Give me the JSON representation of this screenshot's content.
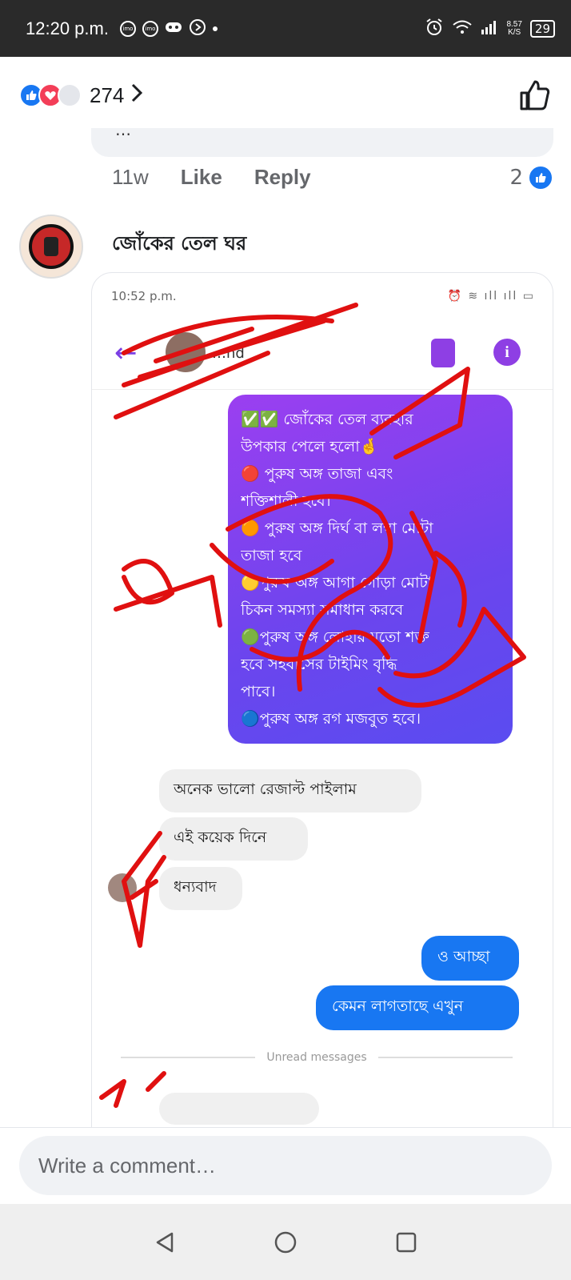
{
  "status_bar": {
    "time": "12:20 p.m.",
    "net_speed_value": "8.57",
    "net_speed_unit": "K/S",
    "battery": "29",
    "icons": [
      "imo-icon",
      "imo-icon",
      "game-icon",
      "play-icon",
      "alarm-icon",
      "wifi-icon",
      "signal-icon"
    ]
  },
  "reactions": {
    "count": "274",
    "types": [
      "like",
      "love"
    ]
  },
  "prev_comment": {
    "partial_text": "…",
    "time": "11w",
    "like_label": "Like",
    "reply_label": "Reply",
    "reaction_count": "2"
  },
  "comment": {
    "author": "জোঁকের তেল ঘর",
    "screenshot": {
      "time": "10:52 p.m.",
      "contact_name": "…nd",
      "purple_message": [
        "✅✅ জোঁকের তেল ব্যবহার",
        "উপকার পেলে হলো🤞",
        "🔴 পুরুষ অঙ্গ তাজা এবং",
        "শক্তিশালী হবে।",
        "🟠 পুরুষ অঙ্গ দির্ঘ বা লম্বা মোটা",
        "তাজা হবে",
        "🟡পুরুষ অঙ্গ আগা গোড়া মোটা",
        "চিকন সমস্যা সমাধান করবে",
        "🟢পুরুষ অঙ্গ লোহার মতো শক্ত",
        "হবে সহবাসের টাইমিং বৃদ্ধি",
        "পাবে।",
        "🔵পুরুষ অঙ্গ রগ মজবুত হবে।"
      ],
      "received": [
        "অনেক ভালো রেজাল্ট পাইলাম",
        "এই কয়েক দিনে",
        "ধন্যবাদ"
      ],
      "sent": [
        "ও আচ্ছা",
        "কেমন লাগতাছে এখুন"
      ],
      "divider_label": "Unread messages"
    }
  },
  "composer": {
    "placeholder": "Write a comment…"
  },
  "colors": {
    "brand_blue": "#1877f2",
    "messenger_purple": "#8e3fe4",
    "scribble_red": "#e01010"
  }
}
